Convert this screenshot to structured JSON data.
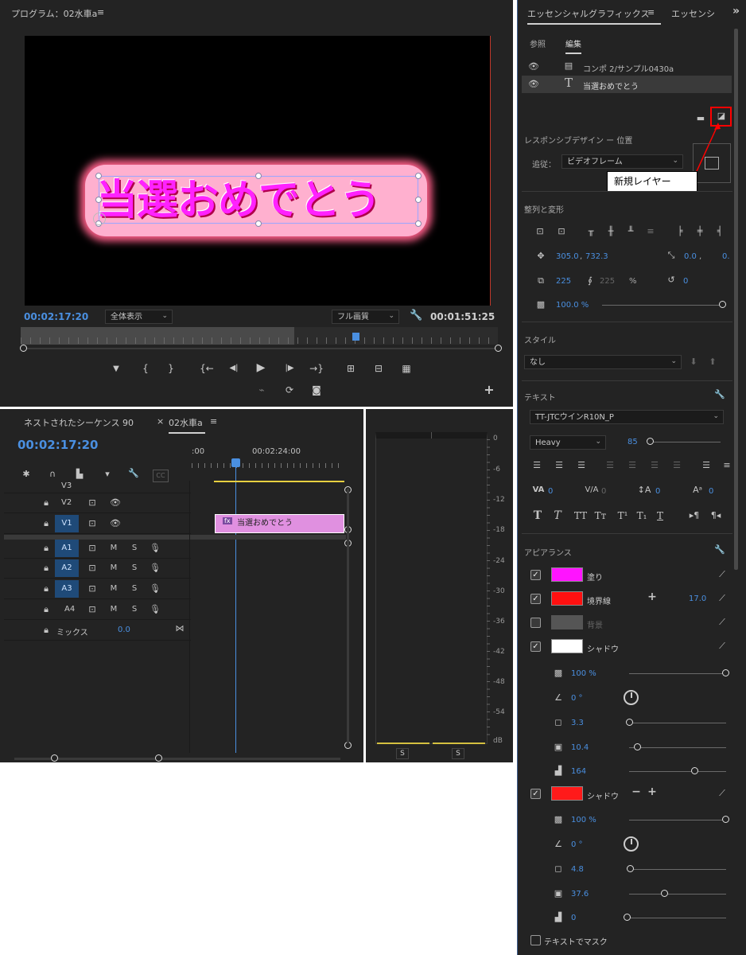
{
  "program": {
    "title": "プログラム：02水車a",
    "menu_icon": "hamburger-icon",
    "clip_text": "当選おめでとう",
    "timecode_left": "00:02:17:20",
    "zoom": "全体表示",
    "quality": "フル画質",
    "timecode_right": "00:01:51:25",
    "transport": {
      "marker": "▼",
      "in": "{",
      "out": "}",
      "goto_in": "{←",
      "step_back": "◀|",
      "play": "▶",
      "step_fwd": "|▶",
      "goto_out": "→}",
      "lift": "⊞",
      "extract": "⊟",
      "export": "▦",
      "snapshot": "📷",
      "add": "+"
    }
  },
  "timeline": {
    "tab_nested": "ネストされたシーケンス 90",
    "tab_close": "×",
    "tab_active": "02水車a",
    "menu_icon": "hamburger-icon",
    "timecode": "00:02:17:20",
    "ruler_start": ":00",
    "ruler_mark": "00:02:24:00",
    "tracks": [
      {
        "name": "V3",
        "source": ""
      },
      {
        "name": "V2",
        "source": ""
      },
      {
        "name": "V1",
        "source": "V1"
      },
      {
        "name": "A1",
        "source": "A1",
        "m": "M",
        "s": "S"
      },
      {
        "name": "A2",
        "source": "A2",
        "m": "M",
        "s": "S"
      },
      {
        "name": "A3",
        "source": "A3",
        "m": "M",
        "s": "S"
      },
      {
        "name": "A4",
        "source": "A4",
        "m": "M",
        "s": "S"
      }
    ],
    "mix_label": "ミックス",
    "mix_value": "0.0",
    "clip_fx": "fx",
    "clip_label": "当選おめでとう",
    "cc": "CC"
  },
  "meter": {
    "scale": [
      "0",
      "-6",
      "-12",
      "-18",
      "-24",
      "-30",
      "-36",
      "-42",
      "-48",
      "-54",
      "dB"
    ],
    "solo_left": "S",
    "solo_right": "S"
  },
  "eg": {
    "tab_active": "エッセンシャルグラフィックス",
    "tab_other": "エッセンシ",
    "expand": "»",
    "subtab_browse": "参照",
    "subtab_edit": "編集",
    "layers": [
      {
        "label": "コンポ 2/サンプル0430a",
        "type": "film-icon"
      },
      {
        "label": "当選おめでとう",
        "type": "text-icon"
      }
    ],
    "tooltip": "新規レイヤー",
    "responsive_title": "レスポンシブデザイン ー 位置",
    "pin_label": "追従：",
    "pin_value": "ビデオフレーム",
    "align_title": "整列と変形",
    "position_x": "305.0",
    "position_y": "732.3",
    "anchor_x": "0.0",
    "anchor_y": "0.",
    "scale": "225",
    "scale_locked": "225",
    "scale_pct": "%",
    "rotation": "0",
    "opacity": "100.0 %",
    "style_title": "スタイル",
    "style_value": "なし",
    "text_title": "テキスト",
    "font": "TT-JTCウインR10N_P",
    "font_style": "Heavy",
    "font_size": "85",
    "tracking": "0",
    "kerning": "0",
    "leading": "0",
    "baseline": "0",
    "appearance_title": "アピアランス",
    "fill_label": "塗り",
    "fill_color": "#ff14ff",
    "stroke_label": "境界線",
    "stroke_color": "#ff1010",
    "stroke_width": "17.0",
    "bg_label": "背景",
    "bg_color": "#555555",
    "shadow_label": "シャドウ",
    "shadow1": {
      "color": "#ffffff",
      "opacity": "100 %",
      "angle": "0 °",
      "distance": "3.3",
      "size": "10.4",
      "blur": "164"
    },
    "shadow2": {
      "color": "#ff1a1a",
      "opacity": "100 %",
      "angle": "0 °",
      "distance": "4.8",
      "size": "37.6",
      "blur": "0"
    },
    "shadow_minus": "−",
    "shadow_plus": "+",
    "mask_label": "テキストでマスク"
  },
  "colors": {
    "accent": "#4a8fe0",
    "panel": "#232323",
    "highlight_red": "#ff0000"
  }
}
